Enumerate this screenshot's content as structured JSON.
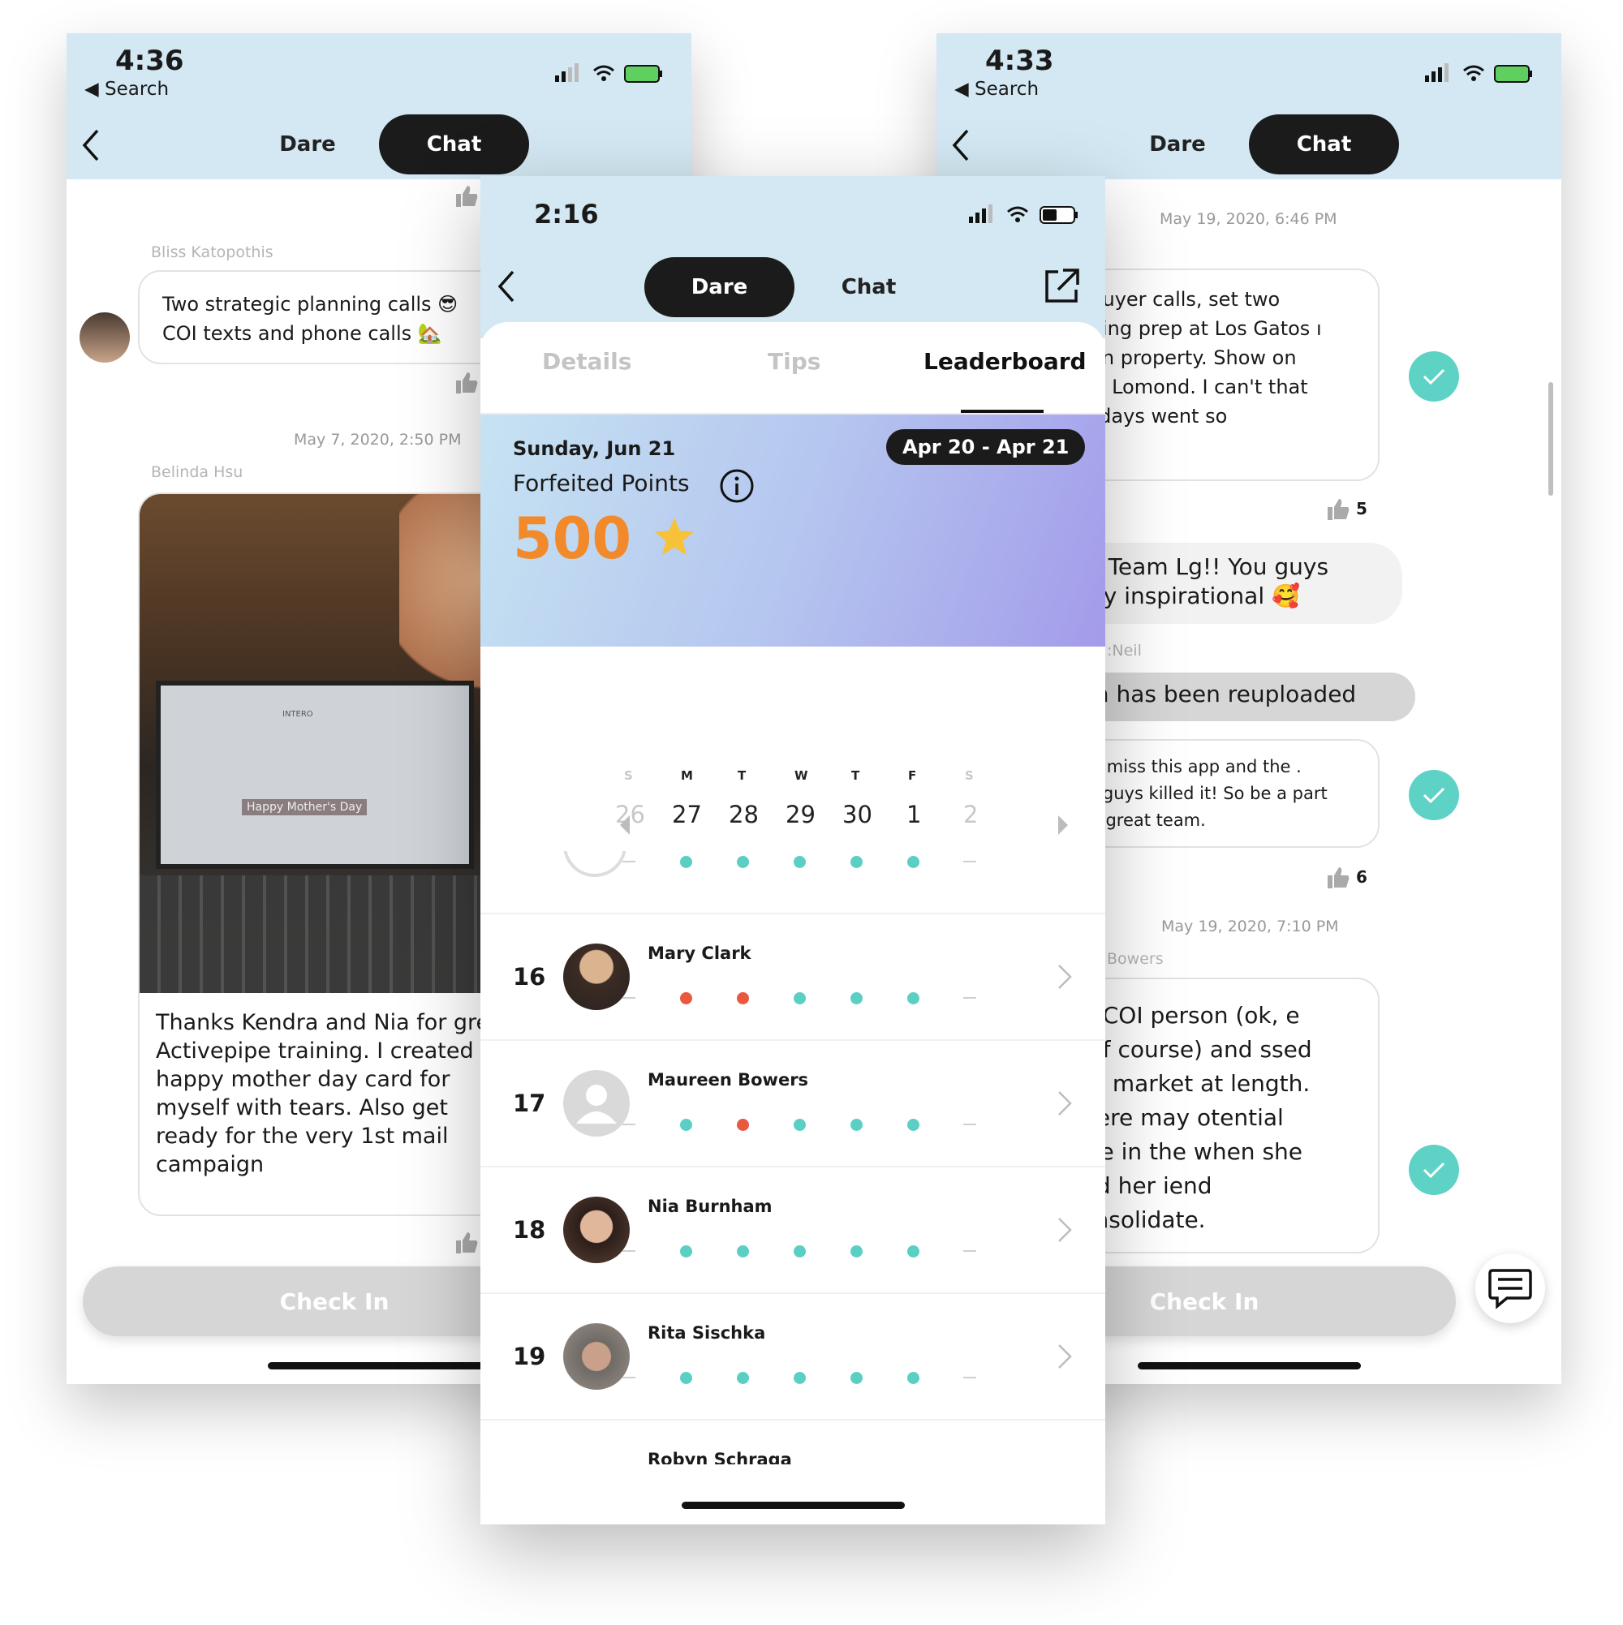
{
  "left_phone": {
    "time": "4:36",
    "back_label": "◀ Search",
    "tabs": {
      "dare": "Dare",
      "chat": "Chat"
    },
    "msg1": {
      "author": "Bliss Katopothis",
      "line1": "Two strategic planning calls 😎",
      "line2": "COI texts and phone calls 🏡"
    },
    "timestamp": "May 7, 2020, 2:50 PM",
    "msg2": {
      "author": "Belinda Hsu",
      "text": "Thanks Kendra and Nia for great Activepipe training. I created happy mother day card for myself with tears. Also get ready for the very 1st mail campaign"
    },
    "photo_text": {
      "brand": "INTERO",
      "card": "Happy Mother's Day"
    },
    "checkin": "Check In"
  },
  "right_phone": {
    "time": "4:33",
    "back_label": "◀ Search",
    "tabs": {
      "dare": "Dare",
      "chat": "Chat"
    },
    "timestamp1": "May 19, 2020, 6:46 PM",
    "msg1": "w buyer calls, set two Listing prep at Los Gatos ı soon property. Show on Ben Lomond. I can't that 30 days went so",
    "like1": "5",
    "msg2": "job Team Lg!! You guys Very inspirational 🥰",
    "msg3_author": ":Neil",
    "msg3": "(-in has been reuploaded",
    "msg4": "g to miss this app and the . You guys killed it! So be a part of a great team.",
    "like2": "6",
    "timestamp2": "May 19, 2020, 7:10 PM",
    "msg5_author": "Bowers",
    "msg5": "ı a COI person (ok, e golf course) and ssed the market at length. There may otential sale in the when she and her iend consolidate.",
    "checkin": "Check In"
  },
  "center_phone": {
    "time": "2:16",
    "tabs": {
      "dare": "Dare",
      "chat": "Chat"
    },
    "subtabs": [
      "Details",
      "Tips",
      "Leaderboard"
    ],
    "active_subtab": "Leaderboard",
    "card": {
      "date": "Sunday, Jun 21",
      "range": "Apr 20 - Apr 21",
      "label": "Forfeited Points",
      "points": "500"
    },
    "week_letters": [
      "S",
      "M",
      "T",
      "W",
      "T",
      "F",
      "S"
    ],
    "week_days": [
      "26",
      "27",
      "28",
      "29",
      "30",
      "1",
      "2"
    ],
    "leaderboard": [
      {
        "rank": "16",
        "name": "Mary Clark",
        "days": [
          "none",
          "miss",
          "miss",
          "done",
          "done",
          "done",
          "none"
        ]
      },
      {
        "rank": "17",
        "name": "Maureen Bowers",
        "days": [
          "none",
          "done",
          "miss",
          "done",
          "done",
          "done",
          "none"
        ]
      },
      {
        "rank": "18",
        "name": "Nia Burnham",
        "days": [
          "none",
          "done",
          "done",
          "done",
          "done",
          "done",
          "none"
        ]
      },
      {
        "rank": "19",
        "name": "Rita Sischka",
        "days": [
          "none",
          "done",
          "done",
          "done",
          "done",
          "done",
          "none"
        ]
      },
      {
        "rank": "",
        "name": "Robyn Schraga",
        "days": []
      }
    ]
  },
  "colors": {
    "header": "#d3e8f3",
    "accent_orange": "#f28a2c",
    "done_teal": "#5ccfc4",
    "miss_red": "#e9583f",
    "dark": "#1b1b1b"
  }
}
